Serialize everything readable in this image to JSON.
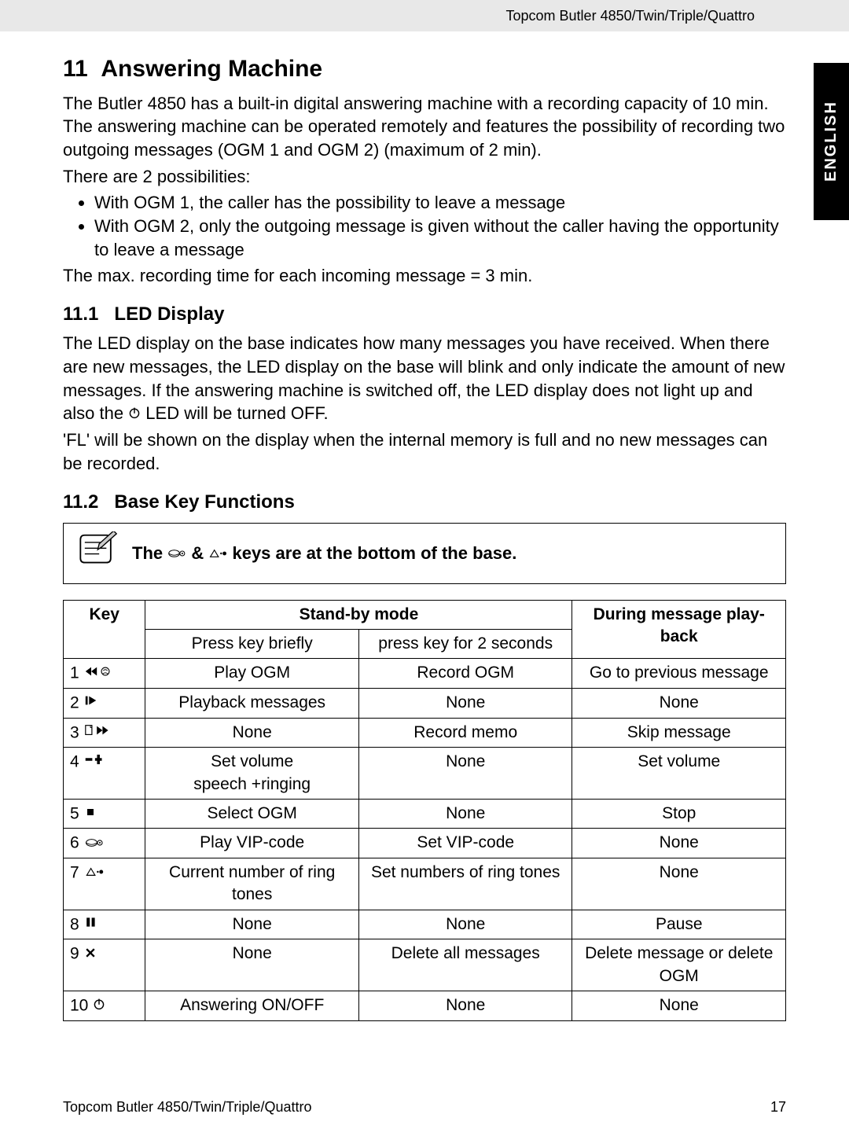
{
  "header": {
    "product": "Topcom Butler 4850/Twin/Triple/Quattro"
  },
  "side_tab": "ENGLISH",
  "section": {
    "number": "11",
    "title": "Answering Machine",
    "intro_p1": "The Butler 4850 has a built-in digital answering machine with a recording capacity of 10 min. The answering machine can be operated remotely and features the possibility of recording two outgoing messages (OGM 1 and OGM 2) (maximum of 2 min).",
    "intro_p2": "There are 2 possibilities:",
    "bullets": [
      "With OGM 1, the caller has the possibility to leave a message",
      "With OGM 2, only the outgoing message is given without the caller having the opportunity to leave a message"
    ],
    "intro_p3": "The max. recording time for each incoming message = 3 min."
  },
  "sub1": {
    "number": "11.1",
    "title": "LED Display",
    "p1a": "The LED display on the base indicates how many messages you have received. When there are new messages, the LED display on the base will blink and only indicate the amount of new messages. If the answering machine is switched off, the LED display does not light up and also the ",
    "p1b": " LED will be turned OFF.",
    "p2": "'FL' will be shown on the display when the internal memory is full and no new messages can be recorded."
  },
  "sub2": {
    "number": "11.2",
    "title": "Base Key Functions",
    "note_a": "The ",
    "note_b": " & ",
    "note_c": " keys are at the bottom of the base."
  },
  "table": {
    "headers": {
      "key": "Key",
      "standby": "Stand-by mode",
      "press_brief": "Press key briefly",
      "press_2s": "press key for 2 seconds",
      "playback": "During message play-back"
    },
    "rows": [
      {
        "num": "1",
        "icon": "rewind-ogm",
        "brief": "Play OGM",
        "long": "Record OGM",
        "play": "Go to previous message"
      },
      {
        "num": "2",
        "icon": "play",
        "brief": "Playback messages",
        "long": "None",
        "play": "None"
      },
      {
        "num": "3",
        "icon": "memo-ffwd",
        "brief": "None",
        "long": "Record memo",
        "play": "Skip message"
      },
      {
        "num": "4",
        "icon": "volume",
        "brief": "Set volume\nspeech +ringing",
        "long": "None",
        "play": "Set volume"
      },
      {
        "num": "5",
        "icon": "stop",
        "brief": "Select OGM",
        "long": "None",
        "play": "Stop"
      },
      {
        "num": "6",
        "icon": "vip",
        "brief": "Play VIP-code",
        "long": "Set VIP-code",
        "play": "None"
      },
      {
        "num": "7",
        "icon": "ring",
        "brief": "Current number of ring tones",
        "long": "Set numbers of ring tones",
        "play": "None"
      },
      {
        "num": "8",
        "icon": "pause",
        "brief": "None",
        "long": "None",
        "play": "Pause"
      },
      {
        "num": "9",
        "icon": "delete",
        "brief": "None",
        "long": "Delete all messages",
        "play": "Delete message or delete OGM"
      },
      {
        "num": "10",
        "icon": "power",
        "brief": "Answering ON/OFF",
        "long": "None",
        "play": "None"
      }
    ]
  },
  "footer": {
    "left": "Topcom Butler 4850/Twin/Triple/Quattro",
    "right": "17"
  }
}
